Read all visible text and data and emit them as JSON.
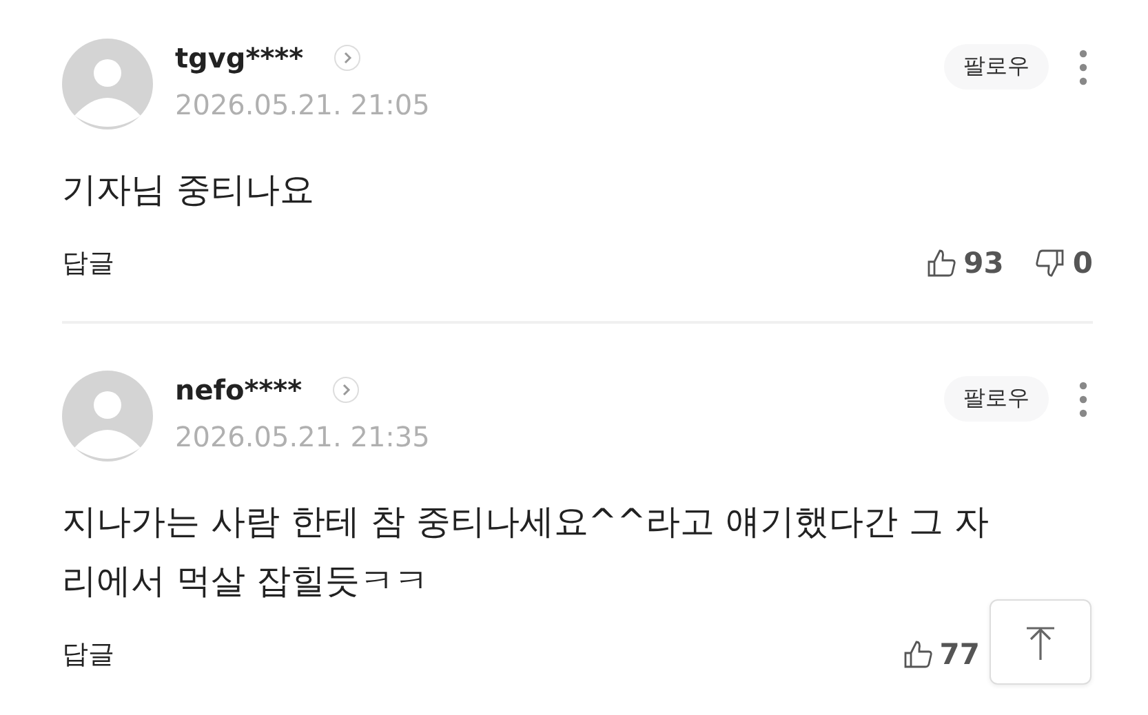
{
  "comments": [
    {
      "author": "tgvg****",
      "date": "2026.05.21. 21:05",
      "follow": "팔로우",
      "body": "기자님 중티나요",
      "reply": "답글",
      "likes": "93",
      "dislikes": "0"
    },
    {
      "author": "nefo****",
      "date": "2026.05.21. 21:35",
      "follow": "팔로우",
      "body": "지나가는 사람 한테 참 중티나세요^^라고 얘기했다간 그 자리에서 먹살 잡힐듯ㅋㅋ",
      "reply": "답글",
      "likes": "77"
    }
  ]
}
